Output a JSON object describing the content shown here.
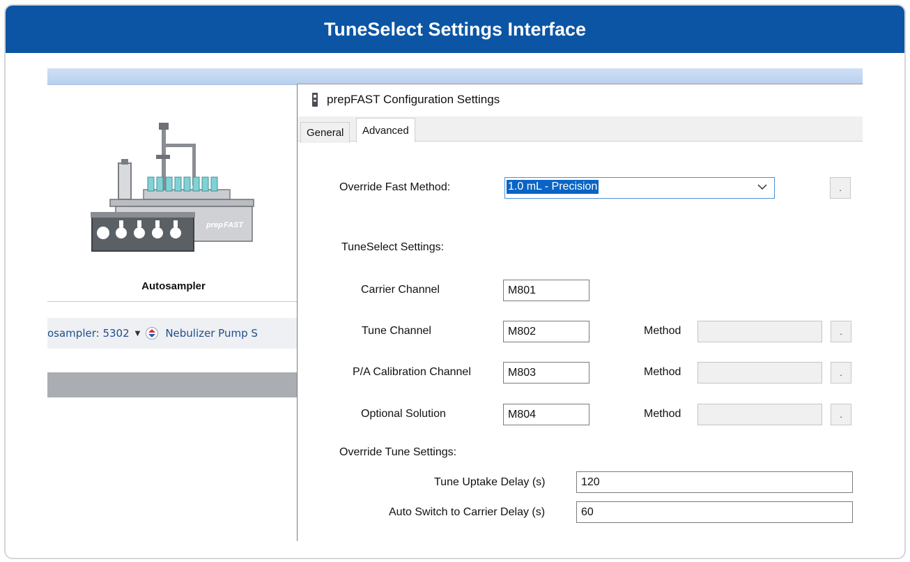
{
  "banner": {
    "title": "TuneSelect Settings Interface"
  },
  "left_app": {
    "device_label": "Autosampler",
    "device_brand": "prepFAST",
    "status": {
      "autosampler_text": "osampler: 5302",
      "nebulizer_text": "Nebulizer Pump S"
    }
  },
  "dialog": {
    "title": "prepFAST Configuration Settings",
    "tabs": [
      {
        "label": "General"
      },
      {
        "label": "Advanced",
        "active": true
      }
    ],
    "override_fast_method": {
      "label": "Override Fast Method:",
      "value": "1.0 mL - Precision",
      "button": "."
    },
    "tuneselect": {
      "heading": "TuneSelect Settings:",
      "method_label": "Method",
      "rows": [
        {
          "label": "Carrier Channel",
          "value": "M801"
        },
        {
          "label": "Tune Channel",
          "value": "M802",
          "button": "."
        },
        {
          "label": "P/A Calibration Channel",
          "value": "M803",
          "button": "."
        },
        {
          "label": "Optional Solution",
          "value": "M804",
          "button": "."
        }
      ]
    },
    "override_tune": {
      "heading": "Override Tune Settings:",
      "uptake_label": "Tune Uptake Delay (s)",
      "uptake_value": "120",
      "switch_label": "Auto Switch to Carrier Delay (s)",
      "switch_value": "60"
    }
  },
  "colors": {
    "banner": "#0b55a4",
    "selection": "#0a64c6",
    "focus_border": "#4a90d9"
  }
}
